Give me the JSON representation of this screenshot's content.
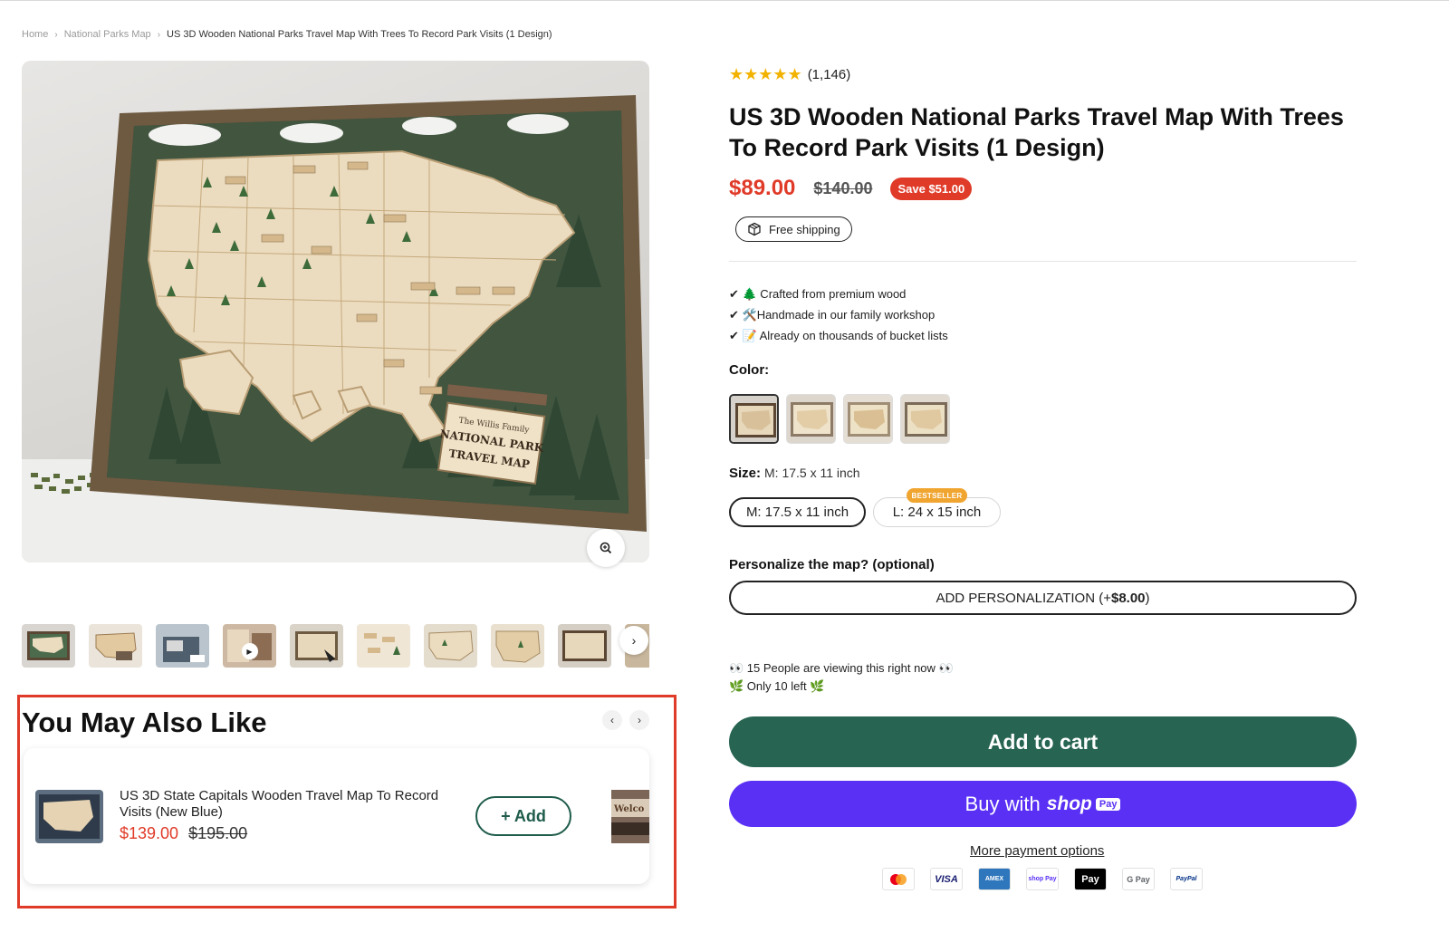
{
  "breadcrumb": {
    "home": "Home",
    "category": "National Parks Map",
    "current": "US 3D Wooden National Parks Travel Map With Trees To Record Park Visits (1 Design)"
  },
  "gallery": {
    "sign_text_1": "The Willis Family",
    "sign_text_2": "NATIONAL PARK",
    "sign_text_3": "TRAVEL MAP",
    "thumbnail_count": 10,
    "active_thumbnail": 1
  },
  "product": {
    "stars": "★★★★★",
    "rating_count": "(1,146)",
    "title": "US 3D Wooden National Parks Travel Map With Trees To Record Park Visits (1 Design)",
    "price": "$89.00",
    "compare_price": "$140.00",
    "save_badge": "Save $51.00",
    "shipping_label": "Free shipping",
    "features": [
      "✔ 🌲 Crafted from premium wood",
      "✔ 🛠️Handmade in our family workshop",
      "✔ 📝 Already on thousands of bucket lists"
    ],
    "color_label": "Color:",
    "size_label": "Size:",
    "size_value": "M: 17.5 x 11 inch",
    "sizes": [
      "M: 17.5 x 11 inch",
      "L: 24 x 15 inch"
    ],
    "bestseller_badge": "BESTSELLER",
    "personalize_label": "Personalize the map? (optional)",
    "personalize_button": "ADD PERSONALIZATION (+",
    "personalize_price": "$8.00",
    "personalize_close": ")",
    "viewers": "👀 15 People are viewing this right now 👀",
    "stock": "🌿 Only 10 left 🌿",
    "add_to_cart": "Add to cart",
    "buy_with": "Buy with",
    "shop_word": "shop",
    "pay_word": "Pay",
    "more_payment": "More payment options",
    "payment_icons": [
      "mastercard-icon",
      "VISA",
      "AMEX",
      "shop Pay",
      "Pay",
      "G Pay",
      "PayPal"
    ]
  },
  "recommendations": {
    "title": "You May Also Like",
    "items": [
      {
        "name": "US 3D State Capitals Wooden Travel Map To Record Visits (New Blue)",
        "price": "$139.00",
        "compare_price": "$195.00",
        "button": "+ Add"
      }
    ],
    "peek_text": "Welco"
  },
  "colors": {
    "accent_red": "#e03a28",
    "cart_green": "#276452",
    "shop_purple": "#5a31f4",
    "star_gold": "#f2b200",
    "bestseller_orange": "#f0a531"
  }
}
